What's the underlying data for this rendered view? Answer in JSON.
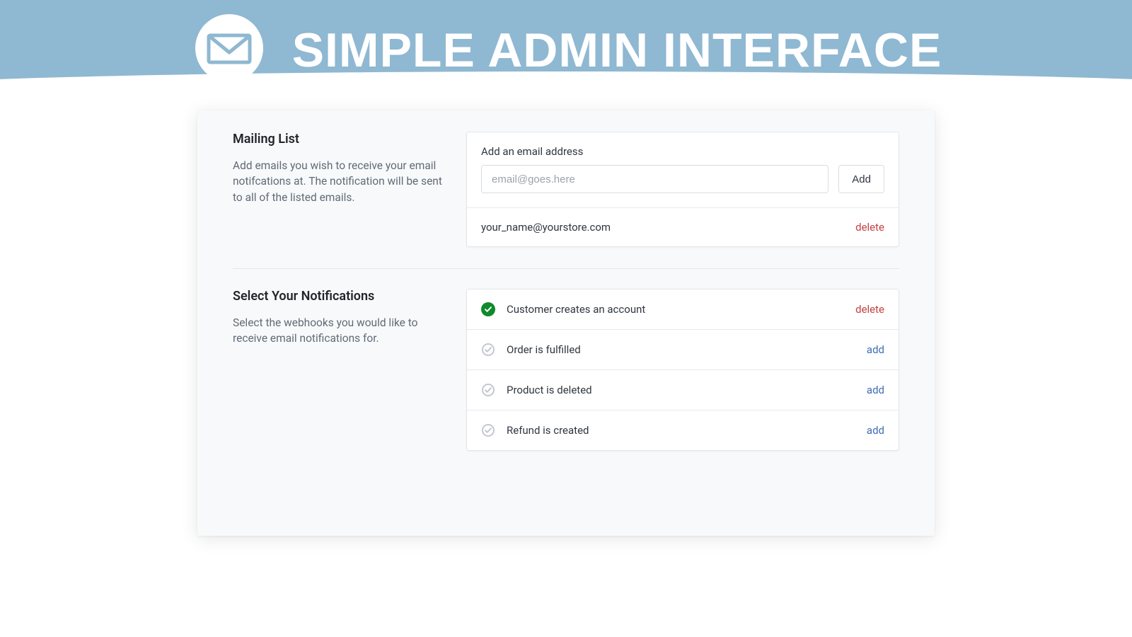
{
  "banner": {
    "title": "SIMPLE ADMIN INTERFACE"
  },
  "mailing": {
    "title": "Mailing List",
    "description": "Add emails you wish to receive your email notifcations at. The notification will be sent to all of the listed emails.",
    "add_label": "Add an email address",
    "placeholder": "email@goes.here",
    "add_button": "Add",
    "emails": [
      {
        "address": "your_name@yourstore.com",
        "delete_label": "delete"
      }
    ]
  },
  "notifications": {
    "title": "Select Your Notifications",
    "description": "Select the webhooks you would like to receive email notifications for.",
    "items": [
      {
        "label": "Customer creates an account",
        "active": true,
        "action_label": "delete"
      },
      {
        "label": "Order is fulfilled",
        "active": false,
        "action_label": "add"
      },
      {
        "label": "Product is deleted",
        "active": false,
        "action_label": "add"
      },
      {
        "label": "Refund is created",
        "active": false,
        "action_label": "add"
      }
    ]
  }
}
